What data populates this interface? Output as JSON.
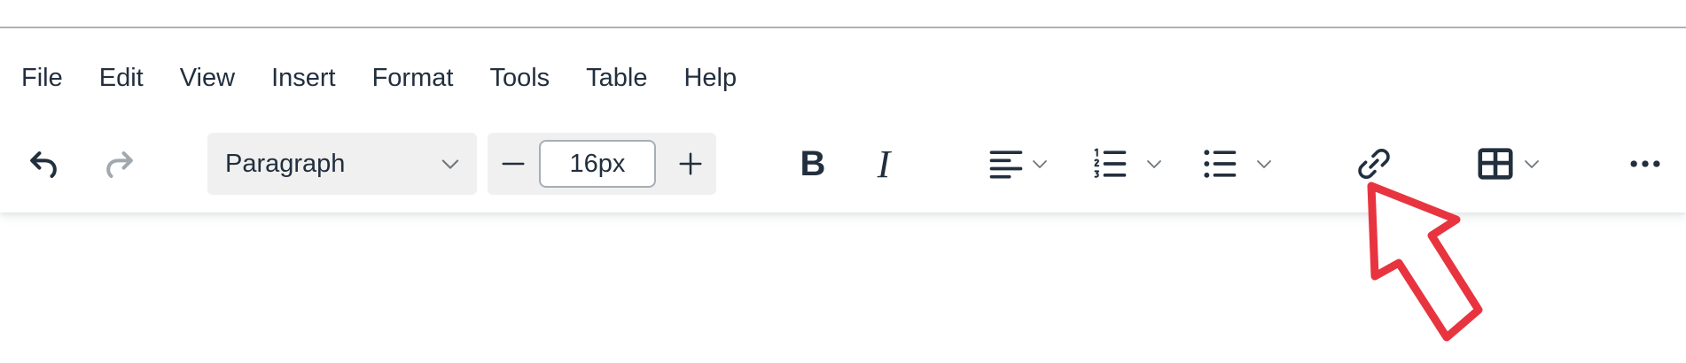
{
  "menubar": {
    "items": [
      "File",
      "Edit",
      "View",
      "Insert",
      "Format",
      "Tools",
      "Table",
      "Help"
    ]
  },
  "toolbar": {
    "undo_icon": "undo-icon",
    "redo_icon": "redo-icon",
    "block_format": {
      "value": "Paragraph",
      "icon": "chevron-down-icon"
    },
    "font_size": {
      "value": "16px",
      "decrease_icon": "minus-icon",
      "increase_icon": "plus-icon"
    },
    "bold_label": "B",
    "italic_label": "I",
    "align_icon": "align-left-icon",
    "numbered_list_icon": "numbered-list-icon",
    "bullet_list_icon": "bullet-list-icon",
    "link_icon": "link-icon",
    "table_icon": "table-icon",
    "more_icon": "more-horizontal-icon"
  },
  "annotation": {
    "pointer_icon": "red-arrow-pointer-icon",
    "pointer_color": "#e8343f"
  },
  "colors": {
    "text": "#222f3e",
    "disabled": "#a1a8ae",
    "button_background": "#f0f0f0",
    "input_border": "#a7aeb5"
  }
}
